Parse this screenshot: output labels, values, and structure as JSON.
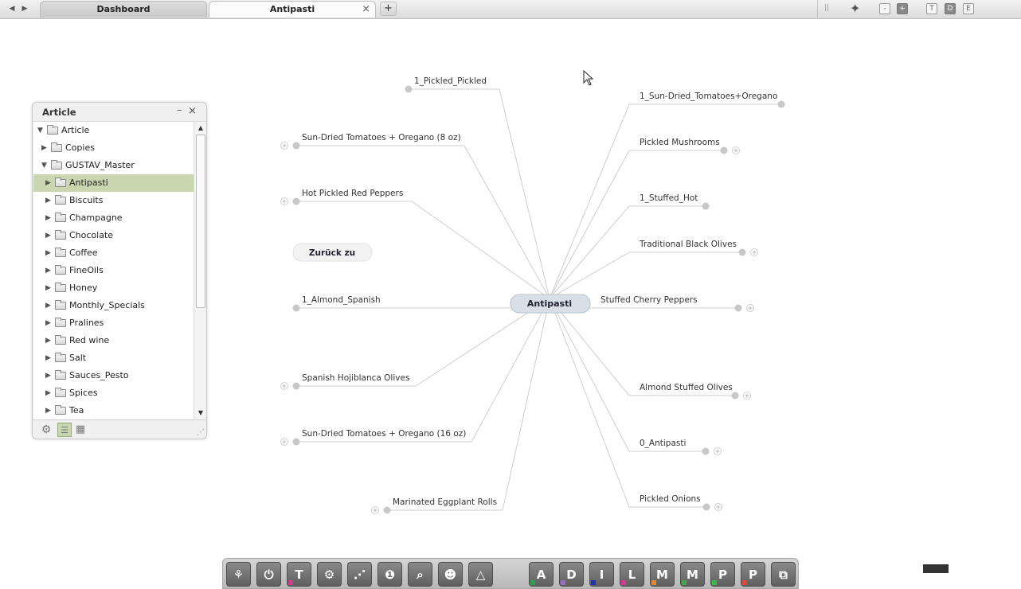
{
  "tabs": {
    "dashboard": "Dashboard",
    "antipasti": "Antipasti",
    "close": "×",
    "add": "+"
  },
  "nav": {
    "back": "◀",
    "forward": "▶"
  },
  "view_controls": {
    "minus": "-",
    "plus": "+",
    "t": "T",
    "d": "D",
    "e": "E",
    "grip": "||"
  },
  "mindmap": {
    "center": "Antipasti",
    "back_button": "Zurück zu",
    "left_nodes": [
      "1_Pickled_Pickled",
      "Sun-Dried Tomatoes + Oregano (8 oz)",
      "Hot Pickled Red Peppers",
      "1_Almond_Spanish",
      "Spanish Hojiblanca Olives",
      "Sun-Dried Tomatoes + Oregano (16 oz)",
      "Marinated Eggplant Rolls"
    ],
    "right_nodes": [
      "1_Sun-Dried_Tomatoes+Oregano",
      "Pickled Mushrooms",
      "1_Stuffed_Hot",
      "Traditional Black Olives",
      "Stuffed Cherry Peppers",
      "Almond Stuffed Olives",
      "0_Antipasti",
      "Pickled Onions"
    ]
  },
  "panel": {
    "title": "Article",
    "minimize": "–",
    "close": "×",
    "tree": [
      "Article",
      "Copies",
      "GUSTAV_Master",
      "Antipasti",
      "Biscuits",
      "Champagne",
      "Chocolate",
      "Coffee",
      "FineOils",
      "Honey",
      "Monthly_Specials",
      "Pralines",
      "Red wine",
      "Salt",
      "Sauces_Pesto",
      "Spices",
      "Tea"
    ],
    "selected": "Antipasti"
  },
  "toolbar": {
    "letters": [
      "A",
      "D",
      "I",
      "L",
      "M",
      "M",
      "P",
      "P"
    ],
    "letter_marks": [
      "#2e9e4a",
      "#9b6fc0",
      "#2233aa",
      "#d23a8f",
      "#e08a3a",
      "#4aa54a",
      "#3ab84a",
      "#e04a3a"
    ],
    "icons": [
      "tree-icon",
      "power-icon",
      "text-icon",
      "gear-icon",
      "share-icon",
      "chat-icon",
      "search-icon",
      "users-icon",
      "network-icon"
    ],
    "text_icon_label": "T",
    "last_icon": "cubes-icon"
  },
  "colors": {
    "accent_selected": "#c9d6b0",
    "edge": "#cccccc",
    "node_dot": "#c8c8c8"
  }
}
